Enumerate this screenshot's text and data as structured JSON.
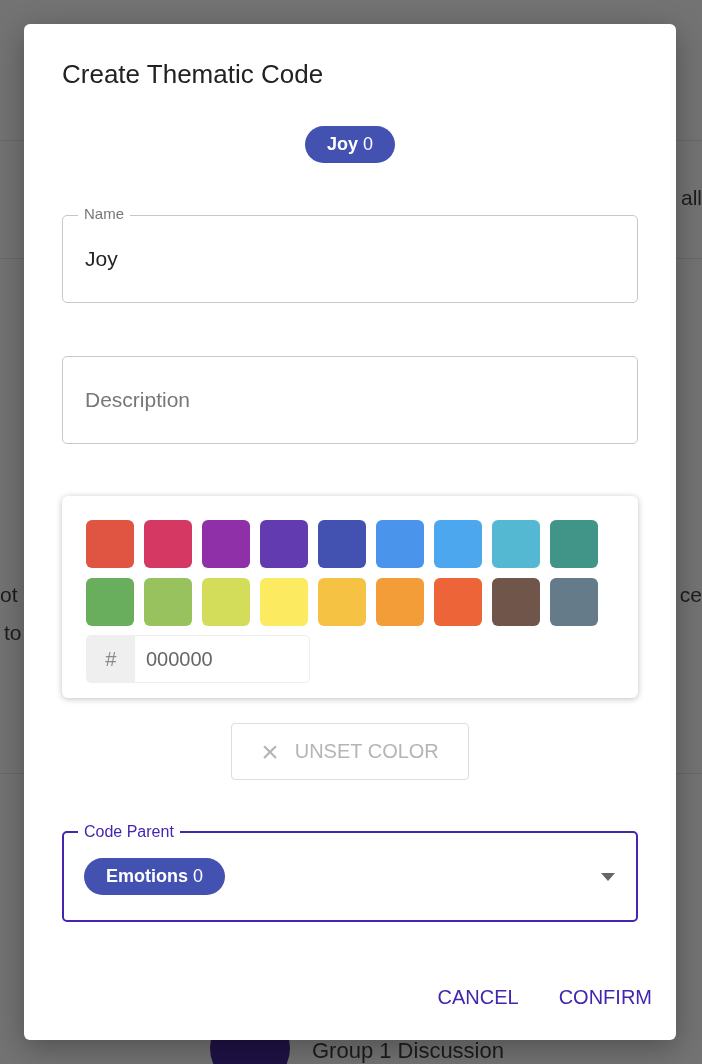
{
  "backdrop": {
    "texts": [
      {
        "text": "all"
      },
      {
        "text": "ot"
      },
      {
        "text": "to"
      },
      {
        "text": "ce"
      }
    ],
    "footer_item": {
      "title": "Group 1 Discussion"
    }
  },
  "dialog": {
    "title": "Create Thematic Code",
    "code_chip": {
      "name": "Joy",
      "count": "0"
    },
    "fields": [
      {
        "label": "Name",
        "value": "Joy"
      },
      {
        "placeholder": "Description"
      }
    ],
    "color_picker": {
      "swatches": [
        {
          "color": "#e05442"
        },
        {
          "color": "#d63864"
        },
        {
          "color": "#8f30a8"
        },
        {
          "color": "#623bb0"
        },
        {
          "color": "#4351b0"
        },
        {
          "color": "#4a94eb"
        },
        {
          "color": "#4da7ee"
        },
        {
          "color": "#55b8d3"
        },
        {
          "color": "#409488"
        },
        {
          "color": "#68ae5c"
        },
        {
          "color": "#98c25e"
        },
        {
          "color": "#d3dd5a"
        },
        {
          "color": "#fcea60"
        },
        {
          "color": "#f6c244"
        },
        {
          "color": "#f29d38"
        },
        {
          "color": "#ec6437"
        },
        {
          "color": "#70564a"
        },
        {
          "color": "#657b89"
        }
      ],
      "hex_prefix": "#",
      "hex_placeholder": "000000"
    },
    "unset_button": {
      "icon": "×",
      "label": "UNSET COLOR",
      "disabled": true
    },
    "parent_field": {
      "label": "Code Parent",
      "focused": true,
      "chip": {
        "name": "Emotions",
        "count": "0"
      }
    },
    "actions": [
      "CANCEL",
      "CONFIRM"
    ]
  }
}
